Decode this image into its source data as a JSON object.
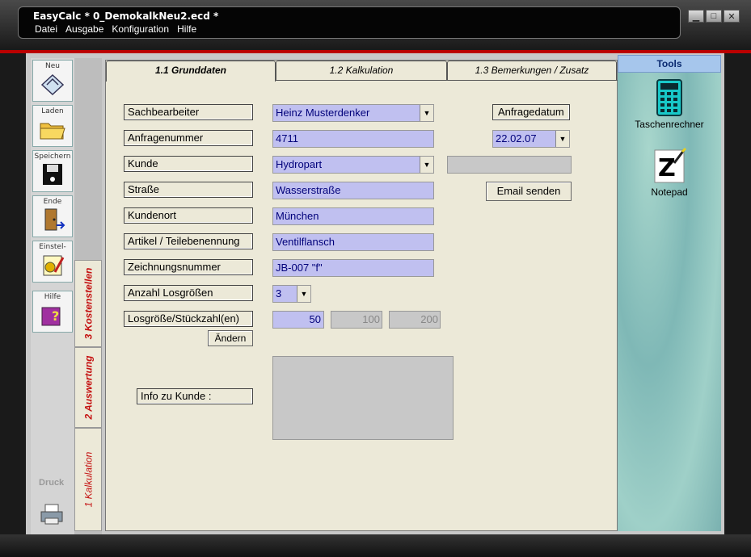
{
  "window": {
    "title": "EasyCalc * 0_DemokalkNeu2.ecd *"
  },
  "menu": [
    "Datei",
    "Ausgabe",
    "Konfiguration",
    "Hilfe"
  ],
  "toolbar": {
    "neu": "Neu",
    "laden": "Laden",
    "speichern": "Speichern",
    "ende": "Ende",
    "einstellungen": "Einstel-",
    "hilfe": "Hilfe",
    "druck": "Druck"
  },
  "side_tabs": [
    "3 Kostenstellen",
    "2 Auswertung",
    "1 Kalkulation"
  ],
  "tabs": [
    "1.1 Grunddaten",
    "1.2 Kalkulation",
    "1.3 Bemerkungen / Zusatz"
  ],
  "form": {
    "sachbearbeiter_label": "Sachbearbeiter",
    "sachbearbeiter_value": "Heinz Musterdenker",
    "anfragenummer_label": "Anfragenummer",
    "anfragenummer_value": "4711",
    "kunde_label": "Kunde",
    "kunde_value": "Hydropart",
    "strasse_label": "Straße",
    "strasse_value": "Wasserstraße",
    "kundenort_label": "Kundenort",
    "kundenort_value": "München",
    "artikel_label": "Artikel / Teilebenennung",
    "artikel_value": "Ventilflansch",
    "zeichnung_label": "Zeichnungsnummer",
    "zeichnung_value": "JB-007   \"f\"",
    "anzahl_label": "Anzahl Losgrößen",
    "anzahl_value": "3",
    "losgroesse_label": "Losgröße/Stückzahl(en)",
    "losgroesse_1": "50",
    "losgroesse_2": "100",
    "losgroesse_3": "200",
    "aendern_button": "Ändern",
    "info_label": "Info zu Kunde :",
    "anfragedatum_label": "Anfragedatum",
    "anfragedatum_value": "22.02.07",
    "email_button": "Email senden"
  },
  "tools": {
    "title": "Tools",
    "items": [
      "Taschenrechner",
      "Notepad"
    ]
  }
}
